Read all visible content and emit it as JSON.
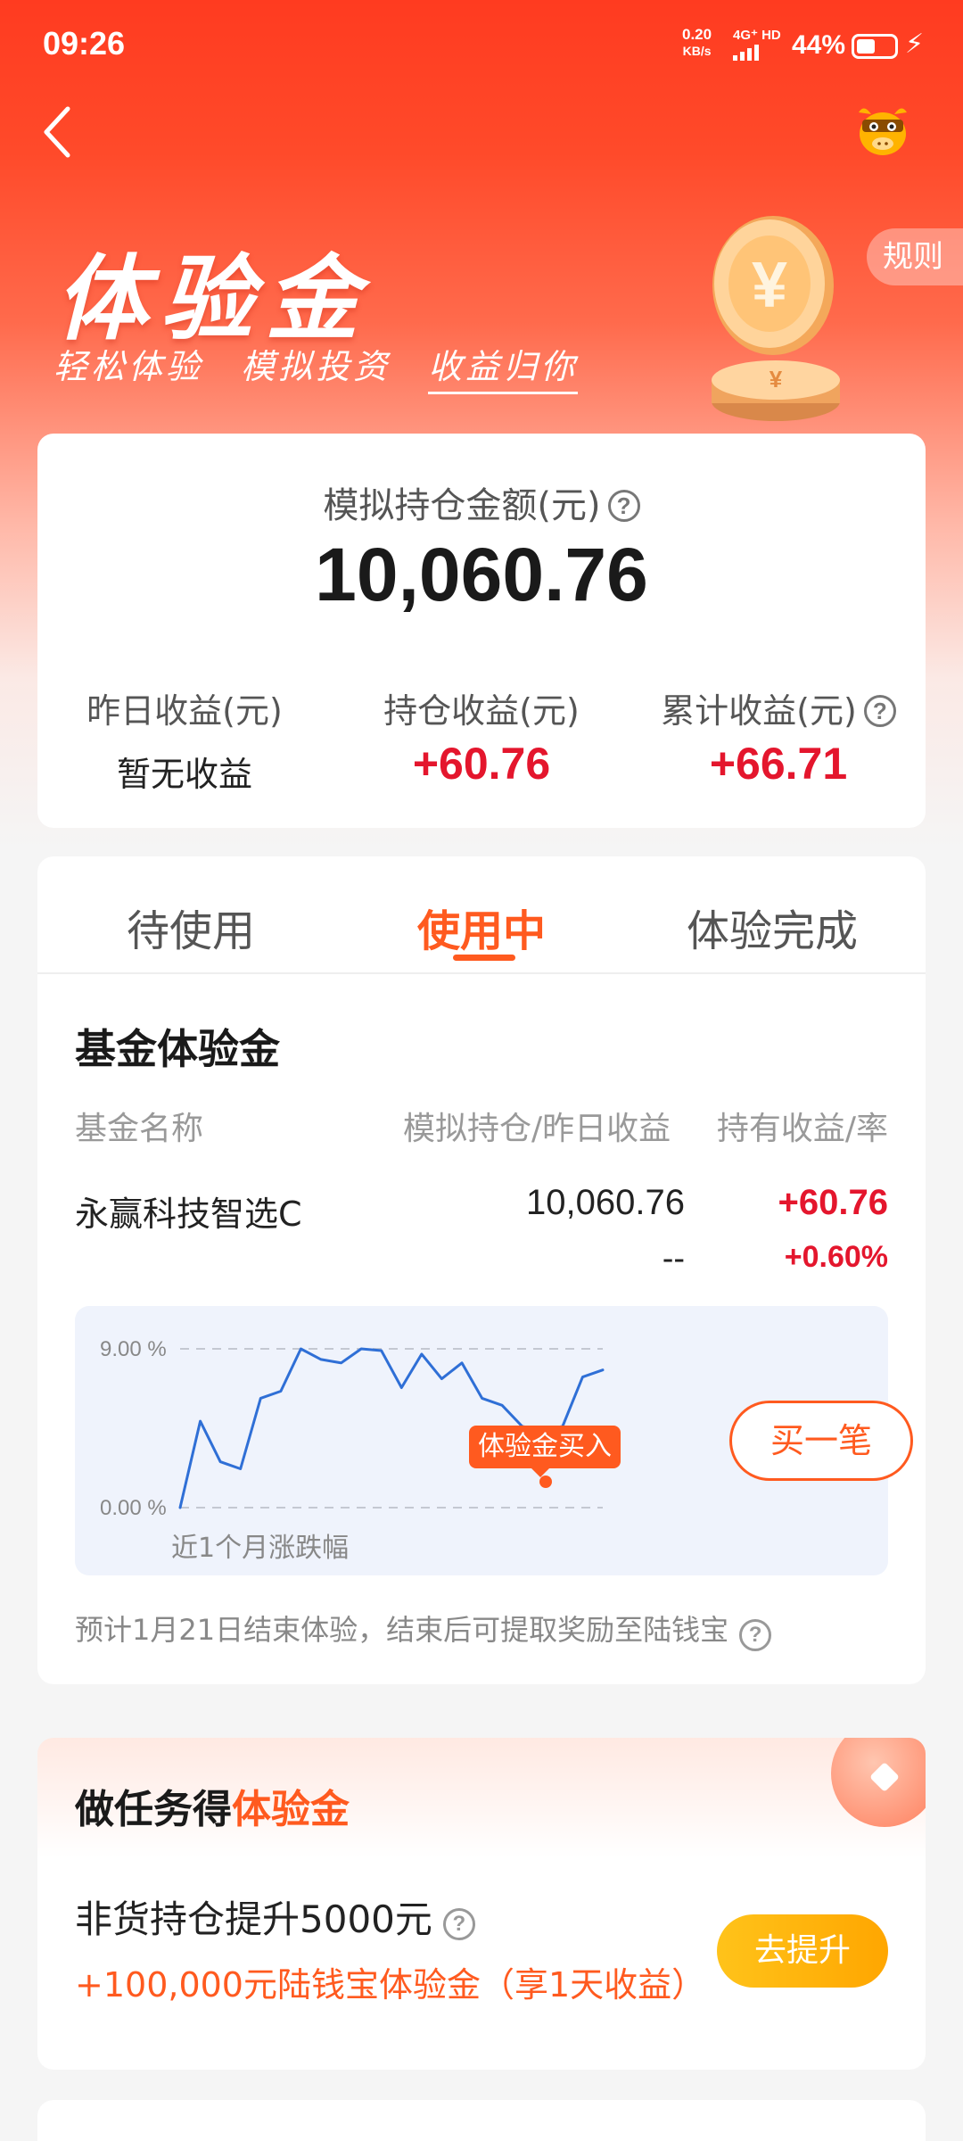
{
  "status_bar": {
    "time": "09:26",
    "net_speed_value": "0.20",
    "net_speed_unit": "KB/s",
    "signal": "4G⁺ HD",
    "battery": "44%",
    "icons": [
      "signal-icon",
      "battery-icon",
      "charging-icon"
    ]
  },
  "nav": {
    "back_icon": "chevron-left-icon",
    "mascot_icon": "bull-mascot-icon"
  },
  "hero": {
    "title": "体验金",
    "slogan": [
      "轻松体验",
      "模拟投资",
      "收益归你"
    ],
    "rules_label": "规则",
    "coin_icon": "yuan-coin-icon"
  },
  "summary": {
    "label": "模拟持仓金额(元)",
    "amount": "10,060.76",
    "stats": [
      {
        "label": "昨日收益(元)",
        "value": "暂无收益"
      },
      {
        "label": "持仓收益(元)",
        "value": "+60.76"
      },
      {
        "label": "累计收益(元)",
        "value": "+66.71"
      }
    ]
  },
  "tabs": [
    {
      "label": "待使用"
    },
    {
      "label": "使用中",
      "active": true
    },
    {
      "label": "体验完成"
    }
  ],
  "fund": {
    "heading": "基金体验金",
    "columns": [
      "基金名称",
      "模拟持仓/昨日收益",
      "持有收益/率"
    ],
    "row": {
      "name": "永赢科技智选C",
      "holding": "10,060.76",
      "yesterday": "--",
      "gain": "+60.76",
      "rate": "+0.60%"
    },
    "chart": {
      "y_top_label": "9.00 %",
      "y_bottom_label": "0.00 %",
      "caption": "近1个月涨跌幅",
      "marker_label": "体验金买入"
    },
    "buy_label": "买一笔",
    "footer": "预计1月21日结束体验，结束后可提取奖励至陆钱宝"
  },
  "chart_data": {
    "type": "line",
    "title": "",
    "xlabel": "近1个月涨跌幅",
    "ylabel": "",
    "ylim": [
      0,
      9
    ],
    "y_ticks": [
      "0.00 %",
      "9.00 %"
    ],
    "grid": true,
    "series": [
      {
        "values": [
          0.0,
          4.9,
          2.6,
          2.2,
          6.2,
          6.6,
          9.0,
          8.4,
          8.2,
          9.0,
          8.9,
          6.8,
          8.7,
          7.3,
          8.2,
          6.2,
          5.8,
          4.6,
          4.4,
          4.6,
          7.4,
          7.8
        ],
        "color": "#2f6fd6"
      }
    ],
    "marker": {
      "label": "体验金买入",
      "index": 18,
      "color": "#ff5a1f"
    }
  },
  "task": {
    "title_prefix": "做任务得",
    "title_highlight": "体验金",
    "item": "非货持仓提升5000元",
    "reward": "+100,000元陆钱宝体验金（享1天收益）",
    "button_label": "去提升"
  },
  "colors": {
    "brand_red": "#ff3b20",
    "accent_orange": "#ff5a1f",
    "profit_red": "#e4162d",
    "button_yellow": "#ffb20d"
  }
}
